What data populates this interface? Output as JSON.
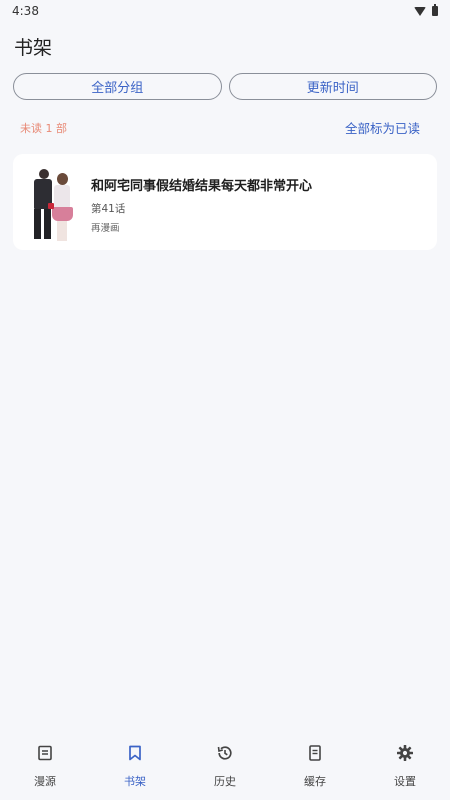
{
  "status": {
    "time": "4:38"
  },
  "header": {
    "title": "书架"
  },
  "filters": {
    "group": "全部分组",
    "sort": "更新时间"
  },
  "info": {
    "unread": "未读 1 部",
    "mark_all_read": "全部标为已读"
  },
  "books": [
    {
      "title": "和阿宅同事假结婚结果每天都非常开心",
      "chapter": "第41话",
      "source": "再漫画"
    }
  ],
  "nav": [
    {
      "label": "漫源",
      "icon": "source-icon"
    },
    {
      "label": "书架",
      "icon": "bookmark-icon",
      "active": true
    },
    {
      "label": "历史",
      "icon": "history-icon"
    },
    {
      "label": "缓存",
      "icon": "cache-icon"
    },
    {
      "label": "设置",
      "icon": "gear-icon"
    }
  ],
  "colors": {
    "accent": "#3b63c6",
    "unread": "#e88a76",
    "background": "#f6f7fa"
  }
}
